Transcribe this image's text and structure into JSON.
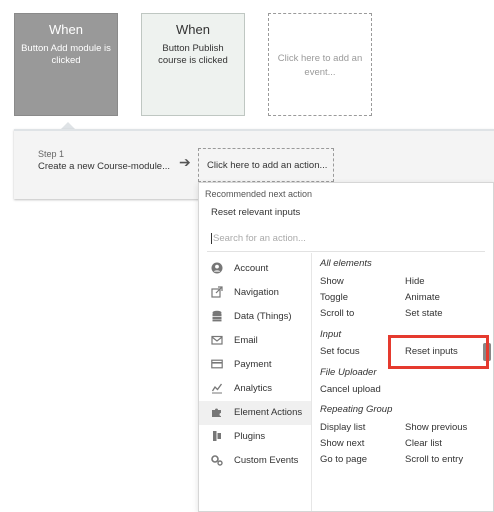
{
  "events": [
    {
      "when": "When",
      "description": "Button Add module is clicked"
    },
    {
      "when": "When",
      "description": "Button Publish course is clicked"
    },
    {
      "description": "Click here to add an event..."
    }
  ],
  "workflow": {
    "step_label": "Step 1",
    "step_name": "Create a new Course-module...",
    "add_action": "Click here to add an action..."
  },
  "dropdown": {
    "recommended_title": "Recommended next action",
    "recommended_item": "Reset relevant inputs",
    "search_placeholder": "Search for an action...",
    "categories": [
      {
        "label": "Account",
        "icon": "account-icon"
      },
      {
        "label": "Navigation",
        "icon": "navigation-icon"
      },
      {
        "label": "Data (Things)",
        "icon": "database-icon"
      },
      {
        "label": "Email",
        "icon": "email-icon"
      },
      {
        "label": "Payment",
        "icon": "payment-icon"
      },
      {
        "label": "Analytics",
        "icon": "analytics-icon"
      },
      {
        "label": "Element Actions",
        "icon": "puzzle-icon",
        "active": true
      },
      {
        "label": "Plugins",
        "icon": "plugins-icon"
      },
      {
        "label": "Custom Events",
        "icon": "gears-icon"
      }
    ],
    "sections": {
      "all_elements": "All elements",
      "input": "Input",
      "file_uploader": "File Uploader",
      "repeating_group": "Repeating Group"
    },
    "actions": {
      "show": "Show",
      "hide": "Hide",
      "toggle": "Toggle",
      "animate": "Animate",
      "scroll_to": "Scroll to",
      "set_state": "Set state",
      "set_focus": "Set focus",
      "reset_inputs": "Reset inputs",
      "cancel_upload": "Cancel upload",
      "display_list": "Display list",
      "show_previous": "Show previous",
      "show_next": "Show next",
      "clear_list": "Clear list",
      "go_to_page": "Go to page",
      "scroll_to_entry": "Scroll to entry"
    }
  },
  "colors": {
    "highlight": "#e53a2e",
    "selected_event": "#999999",
    "event_card": "#eef2ef"
  }
}
